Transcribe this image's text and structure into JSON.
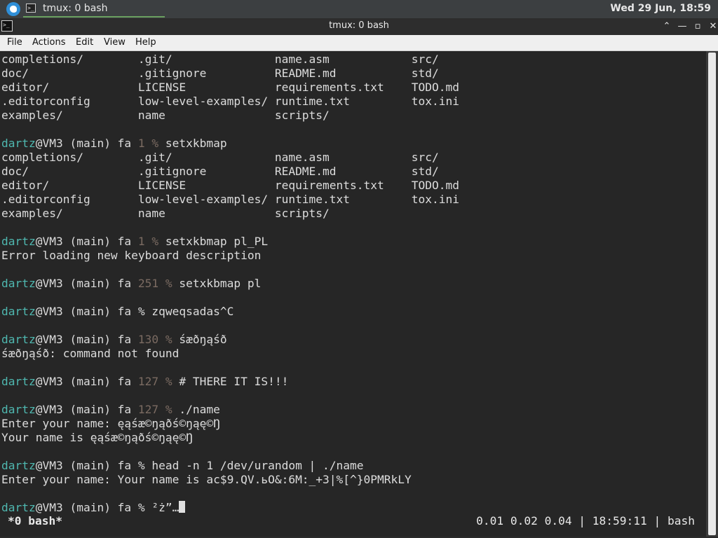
{
  "panel": {
    "task_label": "tmux: 0 bash",
    "clock": "Wed 29 Jun, 18:59",
    "task_icon": "terminal-icon",
    "launcher_icon": "distro-logo-icon"
  },
  "window": {
    "title": "tmux: 0 bash",
    "buttons": [
      "help-icon",
      "minimize-icon",
      "maximize-icon",
      "close-icon"
    ]
  },
  "menu": {
    "file": "File",
    "actions": "Actions",
    "edit": "Edit",
    "view": "View",
    "help": "Help"
  },
  "terminal": {
    "lines": [
      [
        {
          "t": "completions/        .git/               name.asm            src/"
        }
      ],
      [
        {
          "t": "doc/                .gitignore          README.md           std/"
        }
      ],
      [
        {
          "t": "editor/             LICENSE             requirements.txt    TODO.md"
        }
      ],
      [
        {
          "t": ".editorconfig       low-level-examples/ runtime.txt         tox.ini"
        }
      ],
      [
        {
          "t": "examples/           name                scripts/"
        }
      ],
      [
        {
          "t": ""
        }
      ],
      [
        {
          "t": "dartz",
          "c": "u"
        },
        {
          "t": "@VM3 (main) fa "
        },
        {
          "t": "1 %",
          "c": "code"
        },
        {
          "t": " setxkbmap"
        }
      ],
      [
        {
          "t": "completions/        .git/               name.asm            src/"
        }
      ],
      [
        {
          "t": "doc/                .gitignore          README.md           std/"
        }
      ],
      [
        {
          "t": "editor/             LICENSE             requirements.txt    TODO.md"
        }
      ],
      [
        {
          "t": ".editorconfig       low-level-examples/ runtime.txt         tox.ini"
        }
      ],
      [
        {
          "t": "examples/           name                scripts/"
        }
      ],
      [
        {
          "t": ""
        }
      ],
      [
        {
          "t": "dartz",
          "c": "u"
        },
        {
          "t": "@VM3 (main) fa "
        },
        {
          "t": "1 %",
          "c": "code"
        },
        {
          "t": " setxkbmap pl_PL"
        }
      ],
      [
        {
          "t": "Error loading new keyboard description"
        }
      ],
      [
        {
          "t": ""
        }
      ],
      [
        {
          "t": "dartz",
          "c": "u"
        },
        {
          "t": "@VM3 (main) fa "
        },
        {
          "t": "251 %",
          "c": "code"
        },
        {
          "t": " setxkbmap pl"
        }
      ],
      [
        {
          "t": ""
        }
      ],
      [
        {
          "t": "dartz",
          "c": "u"
        },
        {
          "t": "@VM3 (main) fa % zqweqsadas^C"
        }
      ],
      [
        {
          "t": ""
        }
      ],
      [
        {
          "t": "dartz",
          "c": "u"
        },
        {
          "t": "@VM3 (main) fa "
        },
        {
          "t": "130 %",
          "c": "code"
        },
        {
          "t": " śæðŋąśð"
        }
      ],
      [
        {
          "t": "śæðŋąśð: command not found"
        }
      ],
      [
        {
          "t": ""
        }
      ],
      [
        {
          "t": "dartz",
          "c": "u"
        },
        {
          "t": "@VM3 (main) fa "
        },
        {
          "t": "127 %",
          "c": "code"
        },
        {
          "t": " # THERE IT IS!!!"
        }
      ],
      [
        {
          "t": ""
        }
      ],
      [
        {
          "t": "dartz",
          "c": "u"
        },
        {
          "t": "@VM3 (main) fa "
        },
        {
          "t": "127 %",
          "c": "code"
        },
        {
          "t": " ./name"
        }
      ],
      [
        {
          "t": "Enter your name: ęąśæ©ŋąðś©ŋąę©Ŋ"
        }
      ],
      [
        {
          "t": "Your name is ęąśæ©ŋąðś©ŋąę©Ŋ"
        }
      ],
      [
        {
          "t": ""
        }
      ],
      [
        {
          "t": "dartz",
          "c": "u"
        },
        {
          "t": "@VM3 (main) fa % head -n 1 /dev/urandom | ./name"
        }
      ],
      [
        {
          "t": "Enter your name: Your name is ac$9.QV.ьO&:6M:_+3|%[^}0PMRkLY"
        }
      ],
      [
        {
          "t": ""
        }
      ],
      [
        {
          "t": "dartz",
          "c": "u"
        },
        {
          "t": "@VM3 (main) fa % ²ż”…"
        },
        {
          "cursor": true
        }
      ]
    ]
  },
  "status": {
    "window_label": "*0 bash*",
    "right_info": "0.01 0.02 0.04 | 18:59:11 | bash"
  }
}
